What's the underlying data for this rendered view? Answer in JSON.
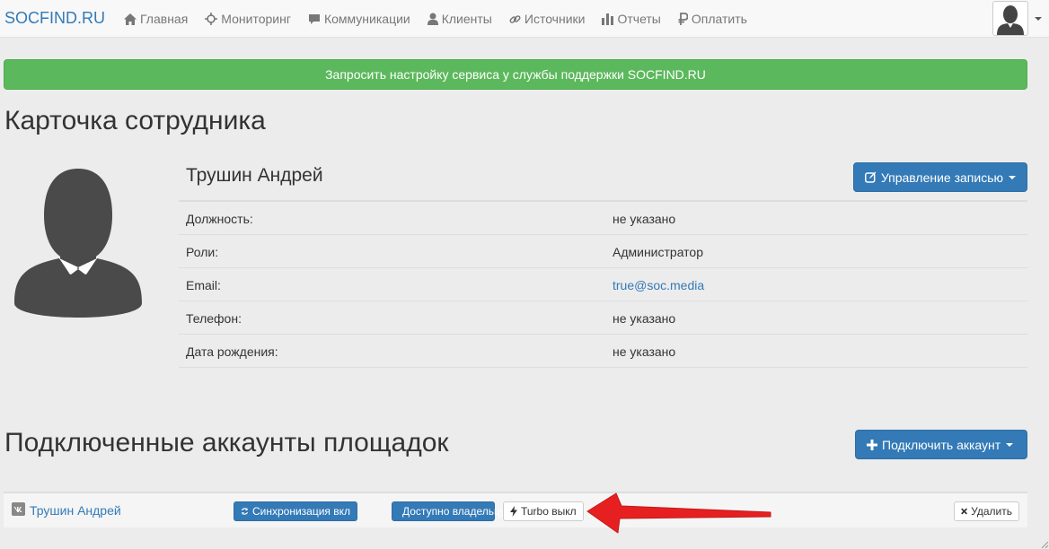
{
  "navbar": {
    "brand": "SOCFIND.RU",
    "items": [
      {
        "label": "Главная",
        "icon": "home-icon"
      },
      {
        "label": "Мониторинг",
        "icon": "crosshair-icon"
      },
      {
        "label": "Коммуникации",
        "icon": "comment-icon"
      },
      {
        "label": "Клиенты",
        "icon": "user-icon"
      },
      {
        "label": "Источники",
        "icon": "link-icon"
      },
      {
        "label": "Отчеты",
        "icon": "bar-chart-icon"
      },
      {
        "label": "Оплатить",
        "icon": "ruble-icon"
      }
    ]
  },
  "support_banner": "Запросить настройку сервиса у службы поддержки SOCFIND.RU",
  "employee_card": {
    "title": "Карточка сотрудника",
    "name": "Трушин Андрей",
    "manage_button": "Управление записью",
    "fields": [
      {
        "label": "Должность:",
        "value": "не указано"
      },
      {
        "label": "Роли:",
        "value": "Администратор"
      },
      {
        "label": "Email:",
        "value": "true@soc.media"
      },
      {
        "label": "Телефон:",
        "value": "не указано"
      },
      {
        "label": "Дата рождения:",
        "value": "не указано"
      }
    ]
  },
  "accounts": {
    "title": "Подключенные аккаунты площадок",
    "connect_button": "Подключить аккаунт",
    "rows": [
      {
        "network_icon": "vk-icon",
        "name": "Трушин Андрей",
        "sync_button": "Синхронизация вкл",
        "owner_button": "Доступно владельцу",
        "turbo_button": "Turbo выкл",
        "delete_button": "Удалить"
      }
    ]
  },
  "colors": {
    "primary": "#337ab7",
    "success": "#5cb85c",
    "annotation_arrow": "#e62020"
  }
}
